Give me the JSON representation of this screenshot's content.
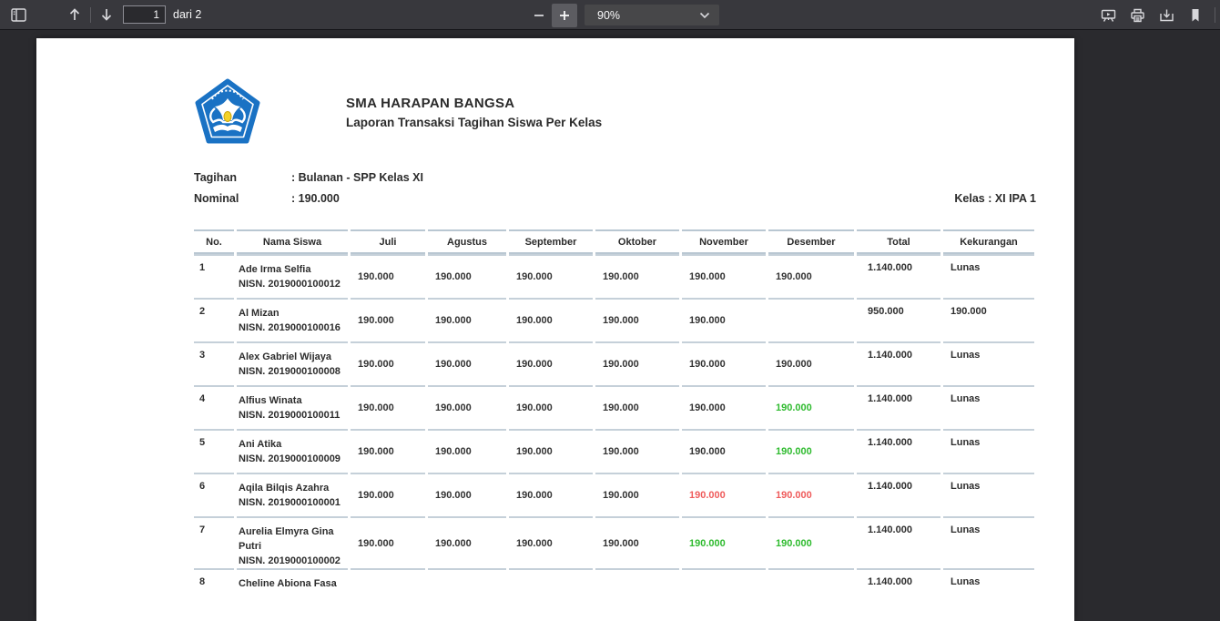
{
  "toolbar": {
    "page_input_value": "1",
    "page_count_label": "dari 2",
    "zoom_label": "90%",
    "icons": [
      "sidebar-toggle-icon",
      "page-up-icon",
      "page-down-icon",
      "zoom-out-icon",
      "zoom-in-icon",
      "presentation-mode-icon",
      "print-icon",
      "download-icon",
      "bookmark-icon"
    ],
    "colors": {
      "toolbar_bg": "#38383d",
      "viewer_bg": "#2a2a2e",
      "icon": "#d7d7db"
    }
  },
  "document": {
    "school_name": "SMA HARAPAN BANGSA",
    "report_title": "Laporan Transaksi Tagihan Siswa Per Kelas",
    "logo_name": "tut-wuri-handayani-logo",
    "info": {
      "tagihan_label": "Tagihan",
      "tagihan_value": ": Bulanan - SPP Kelas XI",
      "nominal_label": "Nominal",
      "nominal_value": ": 190.000",
      "kelas_value": "Kelas : XI IPA 1"
    },
    "colors": {
      "normal": "#333333",
      "green": "#2fbb2f",
      "red": "#ef5b5b",
      "border": "#c5d0d9",
      "logo_blue": "#1a72c4"
    },
    "table": {
      "headers": [
        "No.",
        "Nama Siswa",
        "Juli",
        "Agustus",
        "September",
        "Oktober",
        "November",
        "Desember",
        "Total",
        "Kekurangan"
      ],
      "rows": [
        {
          "no": "1",
          "name": "Ade Irma Selfia",
          "nisn": "NISN. 2019000100012",
          "months": [
            {
              "value": "190.000",
              "status": "normal"
            },
            {
              "value": "190.000",
              "status": "normal"
            },
            {
              "value": "190.000",
              "status": "normal"
            },
            {
              "value": "190.000",
              "status": "normal"
            },
            {
              "value": "190.000",
              "status": "normal"
            },
            {
              "value": "190.000",
              "status": "normal"
            }
          ],
          "total": "1.140.000",
          "kekurangan": "Lunas"
        },
        {
          "no": "2",
          "name": "Al Mizan",
          "nisn": "NISN. 2019000100016",
          "months": [
            {
              "value": "190.000",
              "status": "normal"
            },
            {
              "value": "190.000",
              "status": "normal"
            },
            {
              "value": "190.000",
              "status": "normal"
            },
            {
              "value": "190.000",
              "status": "normal"
            },
            {
              "value": "190.000",
              "status": "normal"
            },
            {
              "value": "",
              "status": "empty"
            }
          ],
          "total": "950.000",
          "kekurangan": "190.000"
        },
        {
          "no": "3",
          "name": "Alex Gabriel Wijaya",
          "nisn": "NISN. 2019000100008",
          "months": [
            {
              "value": "190.000",
              "status": "normal"
            },
            {
              "value": "190.000",
              "status": "normal"
            },
            {
              "value": "190.000",
              "status": "normal"
            },
            {
              "value": "190.000",
              "status": "normal"
            },
            {
              "value": "190.000",
              "status": "normal"
            },
            {
              "value": "190.000",
              "status": "normal"
            }
          ],
          "total": "1.140.000",
          "kekurangan": "Lunas"
        },
        {
          "no": "4",
          "name": "Alfius Winata",
          "nisn": "NISN. 2019000100011",
          "months": [
            {
              "value": "190.000",
              "status": "normal"
            },
            {
              "value": "190.000",
              "status": "normal"
            },
            {
              "value": "190.000",
              "status": "normal"
            },
            {
              "value": "190.000",
              "status": "normal"
            },
            {
              "value": "190.000",
              "status": "normal"
            },
            {
              "value": "190.000",
              "status": "green"
            }
          ],
          "total": "1.140.000",
          "kekurangan": "Lunas"
        },
        {
          "no": "5",
          "name": "Ani Atika",
          "nisn": "NISN. 2019000100009",
          "months": [
            {
              "value": "190.000",
              "status": "normal"
            },
            {
              "value": "190.000",
              "status": "normal"
            },
            {
              "value": "190.000",
              "status": "normal"
            },
            {
              "value": "190.000",
              "status": "normal"
            },
            {
              "value": "190.000",
              "status": "normal"
            },
            {
              "value": "190.000",
              "status": "green"
            }
          ],
          "total": "1.140.000",
          "kekurangan": "Lunas"
        },
        {
          "no": "6",
          "name": "Aqila Bilqis Azahra",
          "nisn": "NISN. 2019000100001",
          "months": [
            {
              "value": "190.000",
              "status": "normal"
            },
            {
              "value": "190.000",
              "status": "normal"
            },
            {
              "value": "190.000",
              "status": "normal"
            },
            {
              "value": "190.000",
              "status": "normal"
            },
            {
              "value": "190.000",
              "status": "red"
            },
            {
              "value": "190.000",
              "status": "red"
            }
          ],
          "total": "1.140.000",
          "kekurangan": "Lunas"
        },
        {
          "no": "7",
          "name": "Aurelia Elmyra Gina Putri",
          "nisn": "NISN. 2019000100002",
          "months": [
            {
              "value": "190.000",
              "status": "normal"
            },
            {
              "value": "190.000",
              "status": "normal"
            },
            {
              "value": "190.000",
              "status": "normal"
            },
            {
              "value": "190.000",
              "status": "normal"
            },
            {
              "value": "190.000",
              "status": "green"
            },
            {
              "value": "190.000",
              "status": "green"
            }
          ],
          "total": "1.140.000",
          "kekurangan": "Lunas"
        },
        {
          "no": "8",
          "name": "Cheline Abiona Fasa",
          "nisn": "",
          "months": [
            {
              "value": "",
              "status": "empty"
            },
            {
              "value": "",
              "status": "empty"
            },
            {
              "value": "",
              "status": "empty"
            },
            {
              "value": "",
              "status": "empty"
            },
            {
              "value": "",
              "status": "empty"
            },
            {
              "value": "",
              "status": "empty"
            }
          ],
          "total": "1.140.000",
          "kekurangan": "Lunas"
        }
      ]
    }
  }
}
